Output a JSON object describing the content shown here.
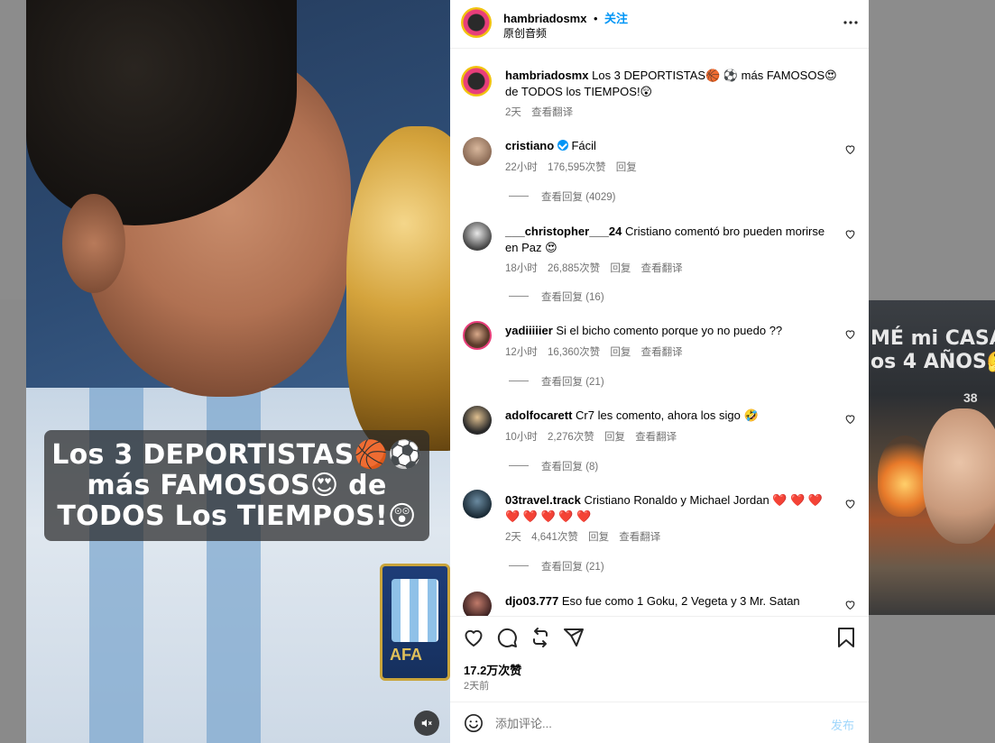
{
  "post": {
    "author": "hambriadosmx",
    "follow_label": "关注",
    "separator": "•",
    "audio_label": "原创音频",
    "caption": "Los 3 DEPORTISTAS🏀 ⚽ más FAMOSOS😍 de TODOS los TIEMPOS!😲",
    "caption_time": "2天",
    "caption_translate": "查看翻译",
    "image_caption_lines": [
      "Los 3 DEPORTISTAS🏀⚽",
      "más FAMOSOS😍 de",
      "TODOS Los TIEMPOS!😲"
    ],
    "likes": "17.2万次赞",
    "posted": "2天前"
  },
  "comments": [
    {
      "user": "cristiano",
      "verified": true,
      "text": "Fácil",
      "time": "22小时",
      "likes": "176,595次赞",
      "reply": "回复",
      "translate": "",
      "view_replies": "查看回复 (4029)"
    },
    {
      "user": "___christopher___24",
      "verified": false,
      "text": "Cristiano comentó bro pueden morirse en Paz 😍",
      "time": "18小时",
      "likes": "26,885次赞",
      "reply": "回复",
      "translate": "查看翻译",
      "view_replies": "查看回复 (16)"
    },
    {
      "user": "yadiiiiier",
      "verified": false,
      "text": "Si el bicho comento porque yo no puedo ??",
      "time": "12小时",
      "likes": "16,360次赞",
      "reply": "回复",
      "translate": "查看翻译",
      "view_replies": "查看回复 (21)"
    },
    {
      "user": "adolfocarett",
      "verified": false,
      "text": "Cr7 les comento, ahora los sigo 🤣",
      "time": "10小时",
      "likes": "2,276次赞",
      "reply": "回复",
      "translate": "查看翻译",
      "view_replies": "查看回复 (8)"
    },
    {
      "user": "03travel.track",
      "verified": false,
      "text": "Cristiano Ronaldo y Michael Jordan ❤️ ❤️ ❤️ ❤️ ❤️ ❤️ ❤️ ❤️",
      "time": "2天",
      "likes": "4,641次赞",
      "reply": "回复",
      "translate": "查看翻译",
      "view_replies": "查看回复 (21)"
    },
    {
      "user": "djo03.777",
      "verified": false,
      "text": "Eso fue como 1 Goku, 2 Vegeta y 3 Mr. Satan",
      "time": "",
      "likes": "",
      "reply": "",
      "translate": "",
      "view_replies": ""
    }
  ],
  "compose": {
    "placeholder": "添加评论...",
    "post_label": "发布"
  },
  "side_thumb": {
    "lines": [
      "MÉ mi CASA",
      "os 4 AÑOS🤔"
    ],
    "number": "38"
  },
  "colors": {
    "accent": "#0095f6",
    "meta": "#737373",
    "heart": "#ed4956",
    "avatar_ring": "#e83e7a"
  },
  "icons": [
    "heart-icon",
    "comment-icon",
    "repost-icon",
    "share-icon",
    "bookmark-icon",
    "more-icon",
    "emoji-icon",
    "mute-icon",
    "verified-icon"
  ]
}
